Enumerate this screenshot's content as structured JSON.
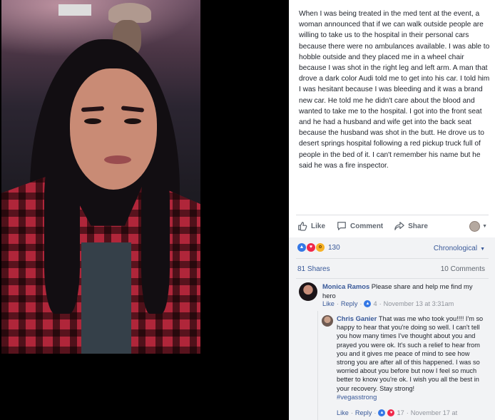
{
  "post": {
    "text": "When I was being treated in the med tent at the event, a woman announced that if we can walk outside people are willing to take us to the hospital in their personal cars because there were no ambulances available. I was able to hobble outside and they placed me in a wheel chair because I was shot in the right leg and left arm. A man that drove a dark color Audi told me to get into his car. I told him I was hesitant because I was bleeding and it was a brand new car. He told me he didn't care about the blood and wanted to take me to the hospital. I got into the front seat and he had a husband and wife get into the back seat because the husband was shot in the butt. He drove us to desert springs hospital following a red pickup truck full of people in the bed of it. I can't remember his name but he said he was a fire inspector.",
    "photo_sign_text": "",
    "actions": {
      "like": "Like",
      "comment": "Comment",
      "share": "Share"
    },
    "viewer_avatar_icon": "user-avatar-icon"
  },
  "stats": {
    "reactions_count": "130",
    "reaction_types": [
      "like",
      "love",
      "wow"
    ],
    "sort": "Chronological",
    "shares": "81 Shares",
    "comments": "10 Comments"
  },
  "comments": [
    {
      "author": "Monica Ramos",
      "text": "Please share and help me find my hero",
      "like": "Like",
      "reply": "Reply",
      "likes": "4",
      "time": "November 13 at 3:31am"
    },
    {
      "author": "Chris Ganier",
      "text": "That was me who took you!!!! I'm so happy to hear that you're doing so well. I can't tell you how many times I've thought about you and prayed you were ok. It's such a relief to hear from you and it gives me peace of mind to see how strong you are after all of this happened. I was so worried about you before but now I feel so much better to know you're ok. I wish you all the best in your recovery. Stay strong!",
      "hashtag": "#vegasstrong",
      "like": "Like",
      "reply": "Reply",
      "likes": "17",
      "time": "November 17 at"
    }
  ],
  "colors": {
    "link": "#385898",
    "text": "#1d2129",
    "muted": "#90949c",
    "like_blue": "#3578e5",
    "love_red": "#f0284a",
    "wow_yellow": "#f7b125"
  }
}
